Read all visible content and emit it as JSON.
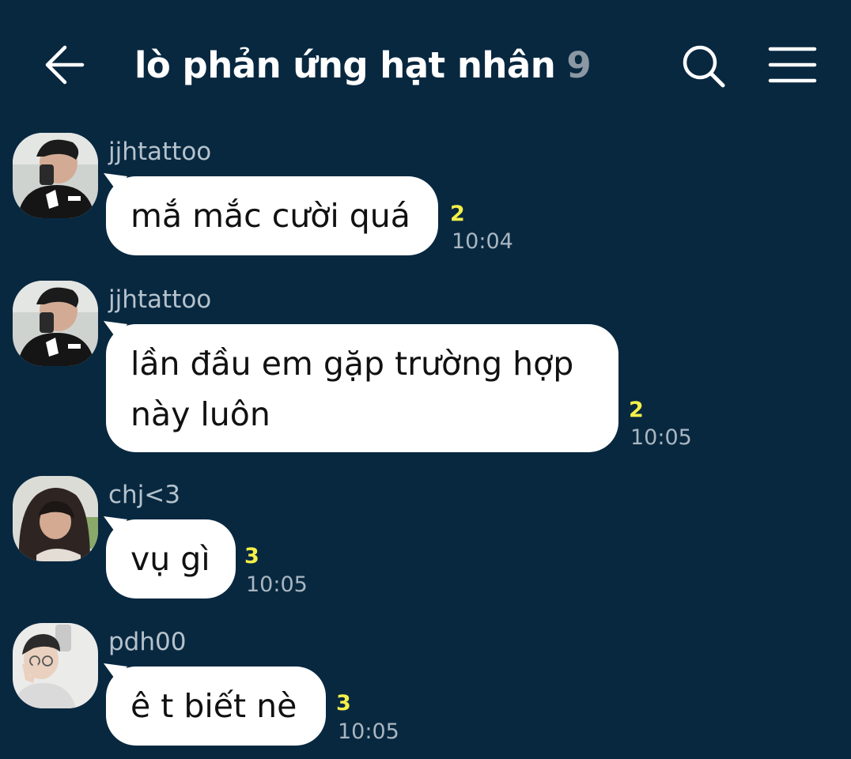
{
  "header": {
    "title": "lò phản ứng hạt nhân",
    "member_count": "9",
    "icons": {
      "back": "arrow-left-icon",
      "search": "search-icon",
      "menu": "hamburger-menu-icon"
    }
  },
  "colors": {
    "background": "#082840",
    "bubble": "#ffffff",
    "unread_count": "#f4ef4a",
    "meta_text": "#a9b6c0"
  },
  "messages": [
    {
      "username": "jjhtattoo",
      "text": "mắ mắc cười quá",
      "unread": "2",
      "time": "10:04"
    },
    {
      "username": "jjhtattoo",
      "text": "lần đầu em gặp trường hợp này luôn",
      "unread": "2",
      "time": "10:05"
    },
    {
      "username": "chj<3",
      "text": "vụ gì",
      "unread": "3",
      "time": "10:05"
    },
    {
      "username": "pdh00",
      "text": "ê t biết nè",
      "unread": "3",
      "time": "10:05"
    }
  ]
}
